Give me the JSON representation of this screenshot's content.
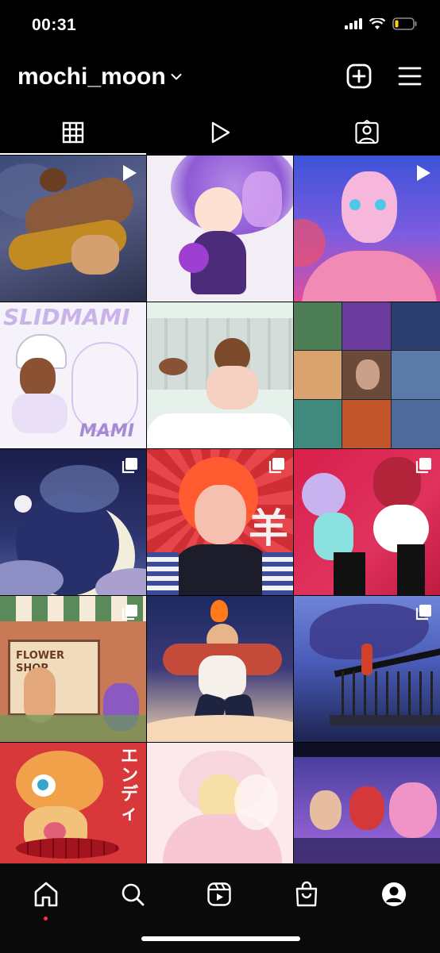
{
  "status_bar": {
    "time": "00:31"
  },
  "header": {
    "username": "mochi_moon"
  },
  "tabs": [
    {
      "name": "posts-grid",
      "icon": "grid-icon",
      "active": true
    },
    {
      "name": "reels",
      "icon": "play-icon",
      "active": false
    },
    {
      "name": "tagged",
      "icon": "tagged-person-icon",
      "active": false
    }
  ],
  "posts": [
    {
      "subject": "sleeping bear couple illustration",
      "type": "reel"
    },
    {
      "subject": "purple-haired star guardian girl",
      "type": "image"
    },
    {
      "subject": "sailor moon style character",
      "type": "reel"
    },
    {
      "subject": "slidmami poster art",
      "type": "image",
      "caption_top": "SLIDMAMI",
      "caption_bottom": "MAMI"
    },
    {
      "subject": "chibi boy running in city",
      "type": "image"
    },
    {
      "subject": "collage of portraits",
      "type": "image"
    },
    {
      "subject": "moon goddess constellation",
      "type": "carousel"
    },
    {
      "subject": "red-haired girl with kanji",
      "type": "carousel",
      "kanji": "羊"
    },
    {
      "subject": "team rocket duo",
      "type": "carousel"
    },
    {
      "subject": "flower shop scene",
      "type": "carousel",
      "sign": "FLOWER SHOP"
    },
    {
      "subject": "elf man with fire",
      "type": "image"
    },
    {
      "subject": "girl on balcony with mecha",
      "type": "carousel"
    },
    {
      "subject": "wendy koopa",
      "type": "image",
      "katakana": "エンディ"
    },
    {
      "subject": "princess peach pastel",
      "type": "image"
    },
    {
      "subject": "star guardian trio",
      "type": "image"
    }
  ],
  "colors": {
    "accent_notification": "#ff3040",
    "background": "#000000"
  }
}
